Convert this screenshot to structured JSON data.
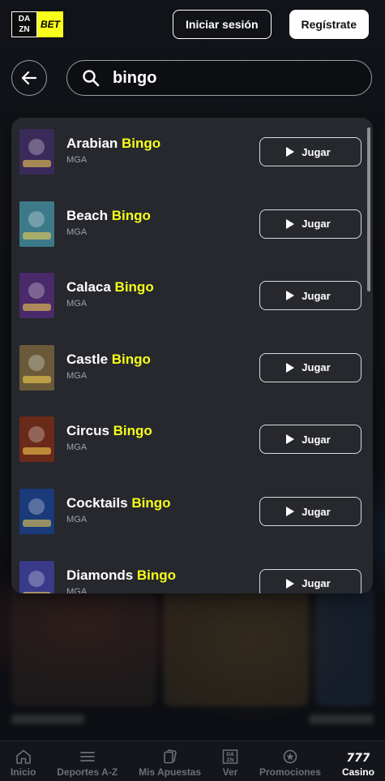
{
  "header": {
    "logo_dazn": [
      "DA",
      "ZN"
    ],
    "logo_bet": "BET",
    "login_label": "Iniciar sesión",
    "register_label": "Regístrate"
  },
  "search": {
    "query": "bingo"
  },
  "results": {
    "play_label": "Jugar",
    "highlight": "Bingo",
    "items": [
      {
        "prefix": "Arabian ",
        "provider": "MGA",
        "thumb_color": "#3a2a5a"
      },
      {
        "prefix": "Beach ",
        "provider": "MGA",
        "thumb_color": "#3c7a8a"
      },
      {
        "prefix": "Calaca ",
        "provider": "MGA",
        "thumb_color": "#4a2a6a"
      },
      {
        "prefix": "Castle ",
        "provider": "MGA",
        "thumb_color": "#6a5a3a"
      },
      {
        "prefix": "Circus ",
        "provider": "MGA",
        "thumb_color": "#6a2a1a"
      },
      {
        "prefix": "Cocktails ",
        "provider": "MGA",
        "thumb_color": "#1a3a7a"
      },
      {
        "prefix": "Diamonds ",
        "provider": "MGA",
        "thumb_color": "#3a3a8a"
      }
    ]
  },
  "bottom_nav": {
    "items": [
      {
        "label": "Inicio",
        "icon": "home-icon"
      },
      {
        "label": "Deportes A-Z",
        "icon": "menu-icon"
      },
      {
        "label": "Mis Apuestas",
        "icon": "betslip-icon"
      },
      {
        "label": "Ver",
        "icon": "dazn-icon"
      },
      {
        "label": "Promociones",
        "icon": "badge-icon"
      },
      {
        "label": "Casino",
        "icon": "slots-777-icon"
      }
    ]
  },
  "colors": {
    "accent": "#f7ff1a",
    "panel": "#26282d",
    "background": "#0d0f14"
  }
}
